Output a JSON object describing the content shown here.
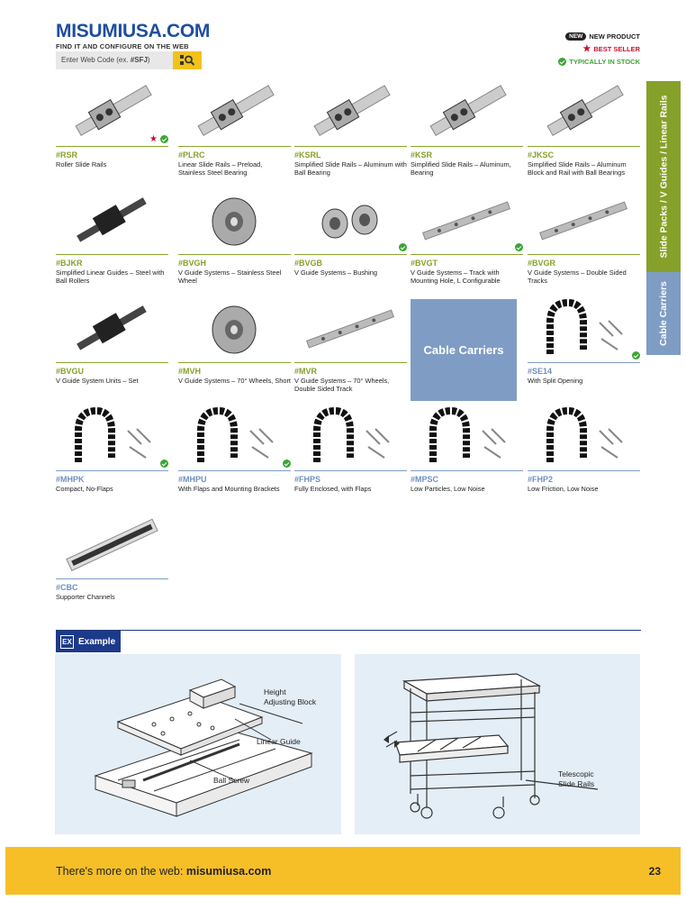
{
  "brand": {
    "logo": "MISUMIUSA.COM",
    "tagline": "FIND IT AND CONFIGURE ON THE WEB"
  },
  "search": {
    "placeholder_prefix": "Enter Web Code (ex. ",
    "placeholder_code": "#SFJ",
    "placeholder_suffix": ")",
    "icon": "search-icon"
  },
  "legend": {
    "new_badge": "NEW",
    "new_label": "NEW PRODUCT",
    "best_label": "BEST SELLER",
    "stock_label": "TYPICALLY IN STOCK"
  },
  "side_tabs": {
    "green": "Slide Packs / V Guides / Linear Rails",
    "blue": "Cable Carriers"
  },
  "colors": {
    "green": "#86a12a",
    "blue": "#7f9dc4",
    "navy": "#1d3a8a",
    "yellow": "#f6bf28",
    "red": "#c8102e"
  },
  "products": [
    {
      "code": "#RSR",
      "desc": "Roller Slide Rails",
      "best": true,
      "stock": true
    },
    {
      "code": "#PLRC",
      "desc": "Linear Slide Rails – Preload, Stainless Steel Bearing"
    },
    {
      "code": "#KSRL",
      "desc": "Simplified Slide Rails – Aluminum with Ball Bearing"
    },
    {
      "code": "#KSR",
      "desc": "Simplified Slide Rails – Aluminum, Bearing"
    },
    {
      "code": "#JKSC",
      "desc": "Simplified Slide Rails – Aluminum Block and Rail with Ball Bearings"
    },
    {
      "code": "#BJKR",
      "desc": "Simplified Linear Guides – Steel with Ball Rollers"
    },
    {
      "code": "#BVGH",
      "desc": "V Guide Systems – Stainless Steel Wheel"
    },
    {
      "code": "#BVGB",
      "desc": "V Guide Systems – Bushing",
      "stock": true
    },
    {
      "code": "#BVGT",
      "desc": "V Guide Systems – Track with Mounting Hole, L Configurable",
      "stock": true
    },
    {
      "code": "#BVGR",
      "desc": "V Guide Systems – Double Sided Tracks"
    },
    {
      "code": "#BVGU",
      "desc": "V Guide System Units – Set"
    },
    {
      "code": "#MVH",
      "desc": "V Guide Systems – 70° Wheels, Short"
    },
    {
      "code": "#MVR",
      "desc": "V Guide Systems – 70° Wheels, Double Sided Track"
    },
    {
      "code": "#SE14",
      "desc": "With Split Opening",
      "stock": true
    },
    {
      "code": "#MHPK",
      "desc": "Compact, No-Flaps",
      "stock": true
    },
    {
      "code": "#MHPU",
      "desc": "With Flaps and Mounting Brackets",
      "stock": true
    },
    {
      "code": "#FHPS",
      "desc": "Fully Enclosed, with Flaps"
    },
    {
      "code": "#MPSC",
      "desc": "Low Particles, Low Noise"
    },
    {
      "code": "#FHP2",
      "desc": "Low Friction, Low Noise"
    },
    {
      "code": "#CBC",
      "desc": "Supporter Channels"
    }
  ],
  "cable_carriers_box": "Cable Carriers",
  "example": {
    "icon_text": "EX",
    "title": "Example",
    "left_labels": {
      "height_block": "Height Adjusting Block",
      "linear_guide": "Linear Guide",
      "ball_screw": "Ball Screw"
    },
    "right_labels": {
      "telescopic": "Telescopic Slide Rails"
    }
  },
  "footer": {
    "prefix": "There's more on the web: ",
    "url": "misumiusa.com",
    "page": "23"
  }
}
